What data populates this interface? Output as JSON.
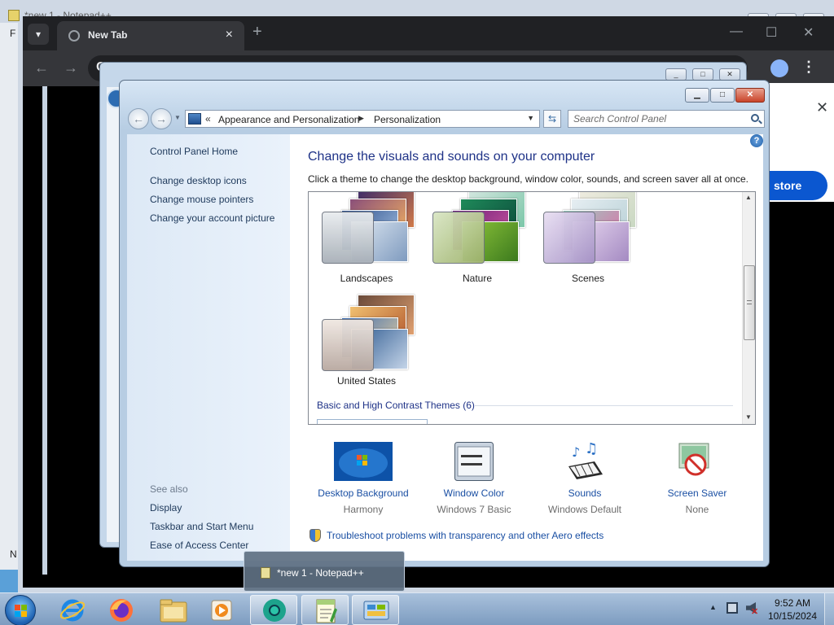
{
  "notepadpp": {
    "title": "*new 1 - Notepad++",
    "left_letters": [
      "F",
      "N"
    ]
  },
  "chrome": {
    "tab_title": "New Tab",
    "new_tab_glyph": "+",
    "omnibox_letter": "C",
    "popup_button": "store",
    "popup_close": "✕"
  },
  "address": {
    "crumbs": [
      "Appearance and Personalization",
      "Personalization"
    ],
    "prefix": "«"
  },
  "search": {
    "placeholder": "Search Control Panel"
  },
  "sidebar": {
    "home": "Control Panel Home",
    "links": [
      "Change desktop icons",
      "Change mouse pointers",
      "Change your account picture"
    ],
    "see_also_header": "See also",
    "see_also": [
      "Display",
      "Taskbar and Start Menu",
      "Ease of Access Center"
    ]
  },
  "main": {
    "title": "Change the visuals and sounds on your computer",
    "subtitle": "Click a theme to change the desktop background, window color, sounds, and screen saver all at once.",
    "help": "?"
  },
  "themes": [
    {
      "label": "Landscapes"
    },
    {
      "label": "Nature"
    },
    {
      "label": "Scenes"
    },
    {
      "label": "United States"
    }
  ],
  "basic_themes_header": "Basic and High Contrast Themes (6)",
  "settings": [
    {
      "label": "Desktop Background",
      "value": "Harmony",
      "icon": "desktop-background-icon"
    },
    {
      "label": "Window Color",
      "value": "Windows 7 Basic",
      "icon": "window-color-icon"
    },
    {
      "label": "Sounds",
      "value": "Windows Default",
      "icon": "sounds-icon"
    },
    {
      "label": "Screen Saver",
      "value": "None",
      "icon": "screen-saver-icon"
    }
  ],
  "troubleshoot_link": "Troubleshoot problems with transparency and other Aero effects",
  "taskbar": {
    "thumbnail_label": "*new 1 - Notepad++",
    "time": "9:52 AM",
    "date": "10/15/2024"
  }
}
